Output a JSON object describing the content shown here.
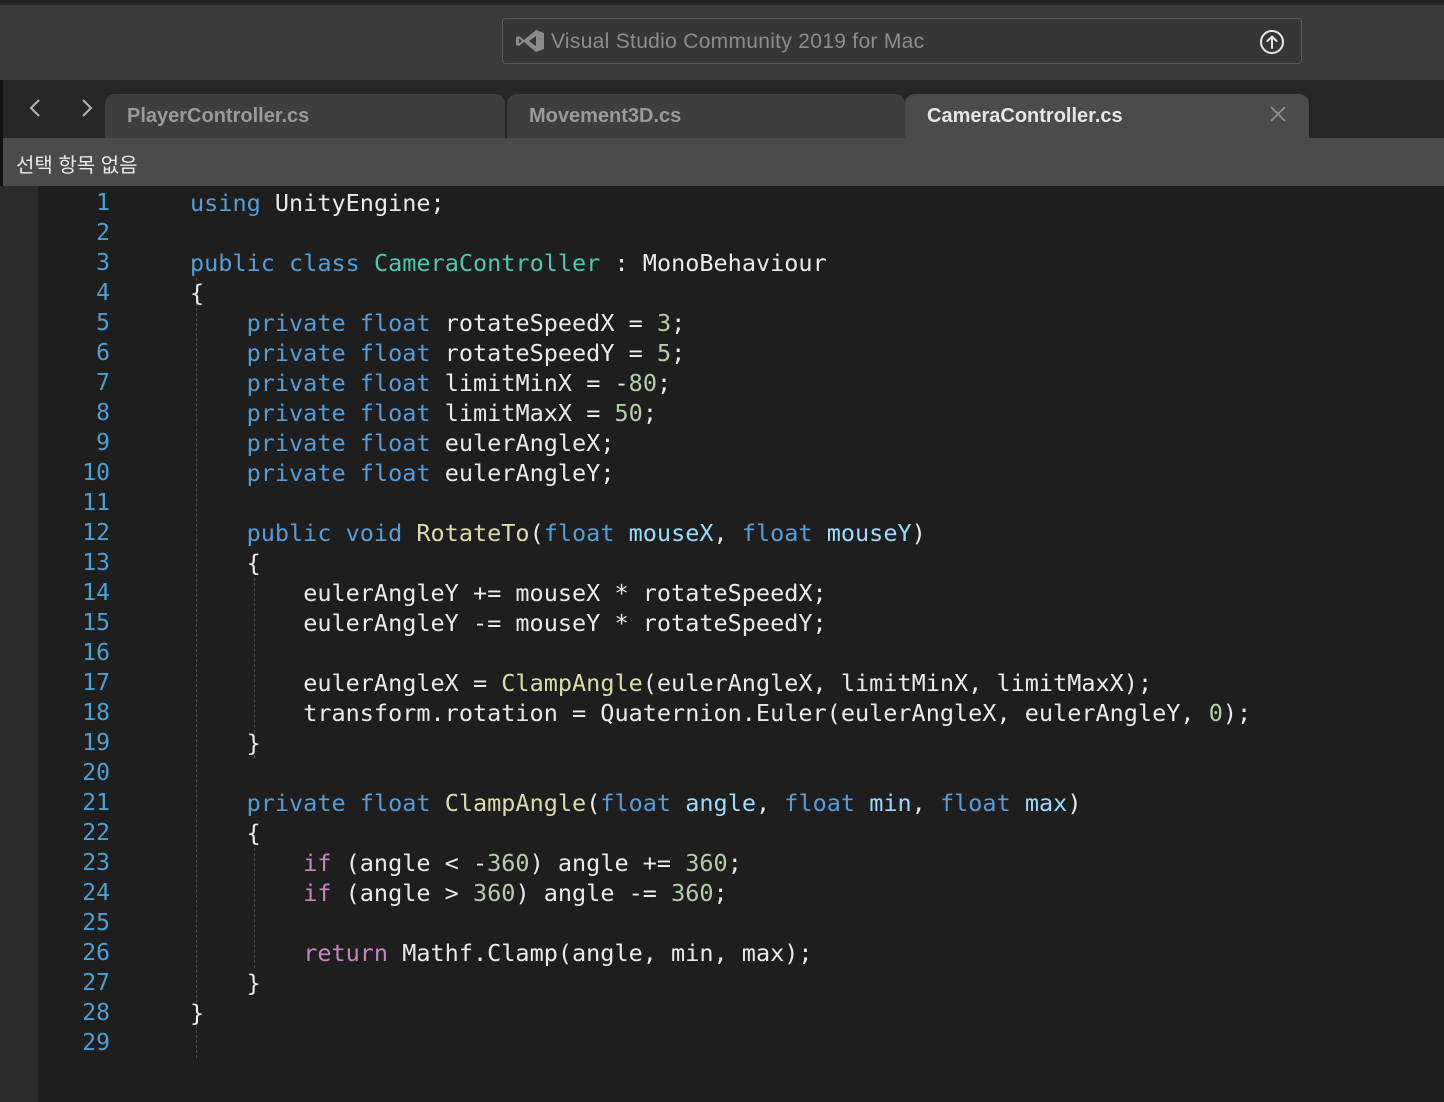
{
  "window": {
    "title": "Visual Studio Community 2019 for Mac"
  },
  "tabs": [
    {
      "label": "PlayerController.cs",
      "active": false
    },
    {
      "label": "Movement3D.cs",
      "active": false
    },
    {
      "label": "CameraController.cs",
      "active": true
    }
  ],
  "breadcrumb": {
    "text": "선택 항목 없음"
  },
  "editor": {
    "line_numbers": [
      "1",
      "2",
      "3",
      "4",
      "5",
      "6",
      "7",
      "8",
      "9",
      "10",
      "11",
      "12",
      "13",
      "14",
      "15",
      "16",
      "17",
      "18",
      "19",
      "20",
      "21",
      "22",
      "23",
      "24",
      "25",
      "26",
      "27",
      "28",
      "29"
    ],
    "code": {
      "using": "using",
      "unity_engine": "UnityEngine;",
      "public": "public",
      "class": "class",
      "class_name": "CameraController",
      "colon": ":",
      "base_class": "MonoBehaviour",
      "open_brace": "{",
      "close_brace": "}",
      "private": "private",
      "float": "float",
      "void": "void",
      "rotate_speed_x": "rotateSpeedX",
      "rotate_speed_y": "rotateSpeedY",
      "limit_min_x": "limitMinX",
      "limit_max_x": "limitMaxX",
      "euler_angle_x_decl": "eulerAngleX;",
      "euler_angle_y_decl": "eulerAngleY;",
      "equals": "=",
      "minus": "-",
      "semicolon": ";",
      "val_3": "3",
      "val_5": "5",
      "val_80": "80",
      "val_50": "50",
      "val_0": "0",
      "val_360": "360",
      "rotate_to": "RotateTo",
      "mouse_x": "mouseX",
      "mouse_y": "mouseY",
      "line14": "eulerAngleY += mouseX * rotateSpeedX;",
      "line15": "eulerAngleY -= mouseY * rotateSpeedY;",
      "euler_angle_x_assign": "eulerAngleX =",
      "clamp_angle": "ClampAngle",
      "clamp_args": "(eulerAngleX, limitMinX, limitMaxX);",
      "line18_head": "transform.rotation = Quaternion.Euler(eulerAngleX, eulerAngleY,",
      "line18_tail": ");",
      "angle": "angle",
      "min": "min",
      "max": "max",
      "if": "if",
      "cond_lt": "(angle <",
      "cond_gt": "(angle >",
      "angle_plus": ") angle +=",
      "angle_minus": ") angle -=",
      "return": "return",
      "mathf_clamp": "Mathf.Clamp(angle, min, max);"
    }
  },
  "colors": {
    "keyword": "#569cd6",
    "control_keyword": "#c586c0",
    "type": "#4ec9b0",
    "number": "#b5cea8",
    "method": "#dcdcaa",
    "parameter": "#9cdcfe",
    "line_number": "#4ba0d4",
    "editor_background": "#1e1e1e"
  },
  "icons": {
    "app_logo": "visual-studio-logo",
    "title_action": "upload-circle-icon",
    "tab_close": "close-icon",
    "nav_back": "chevron-left-icon",
    "nav_forward": "chevron-right-icon"
  }
}
